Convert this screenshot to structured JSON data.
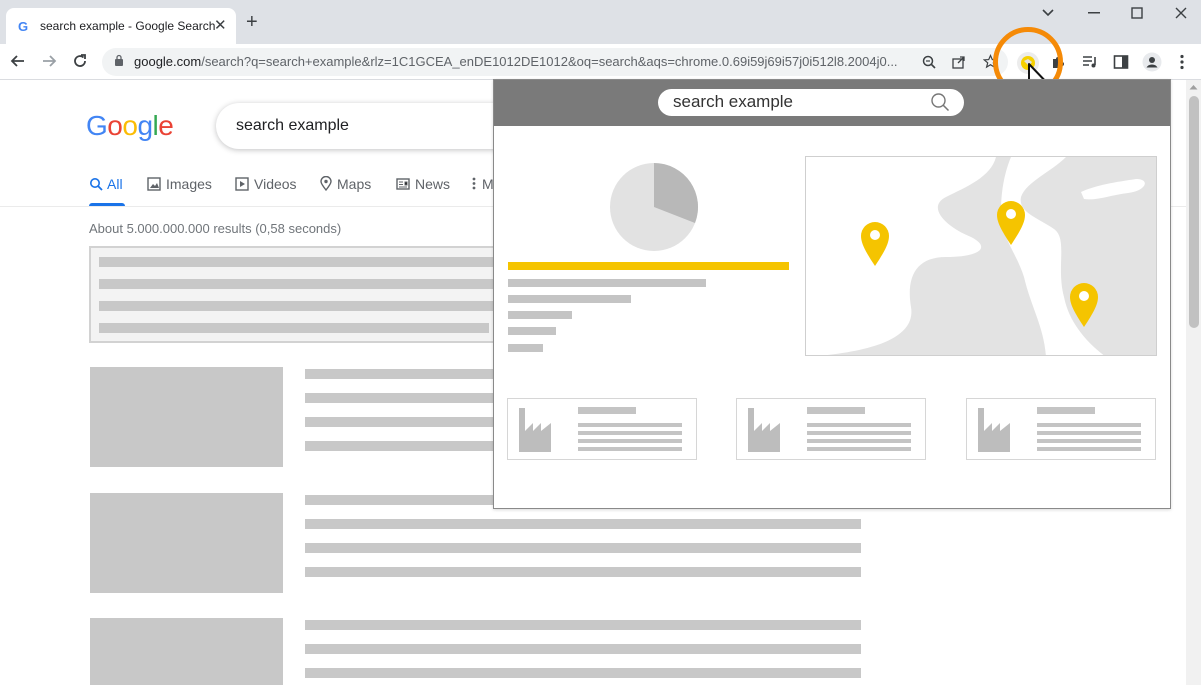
{
  "browser": {
    "tab_title": "search example - Google Search",
    "tab_favicon": "G",
    "tab_close": "✕",
    "new_tab": "+",
    "url_host": "google.com",
    "url_path": "/search?q=search+example&rlz=1C1GCEA_enDE1012DE1012&oq=search&aqs=chrome.0.69i59j69i57j0i512l8.2004j0...",
    "icons": [
      "back-icon",
      "forward-icon",
      "reload-icon",
      "lock-icon",
      "zoom-icon",
      "share-icon",
      "star-icon",
      "extension-map-icon",
      "puzzle-icon",
      "media-icon",
      "sidepanel-icon",
      "profile-icon",
      "menu-icon"
    ]
  },
  "google": {
    "logo": {
      "G": "G",
      "o1": "o",
      "o2": "o",
      "g": "g",
      "l": "l",
      "e": "e"
    },
    "logo_colors": {
      "blue": "#4285f4",
      "red": "#ea4335",
      "yellow": "#fbbc05",
      "green": "#34a853"
    },
    "search_value": "search example",
    "tabs": [
      {
        "label": "All",
        "icon": "search-icon",
        "active": true
      },
      {
        "label": "Images",
        "icon": "image-icon"
      },
      {
        "label": "Videos",
        "icon": "video-icon"
      },
      {
        "label": "Maps",
        "icon": "map-pin-icon"
      },
      {
        "label": "News",
        "icon": "news-icon"
      },
      {
        "label": "M",
        "icon": "more-icon"
      }
    ],
    "results_stats": "About 5.000.000.000 results (0,58 seconds)"
  },
  "popup": {
    "search_value": "search example",
    "accent": "#f5c400"
  }
}
